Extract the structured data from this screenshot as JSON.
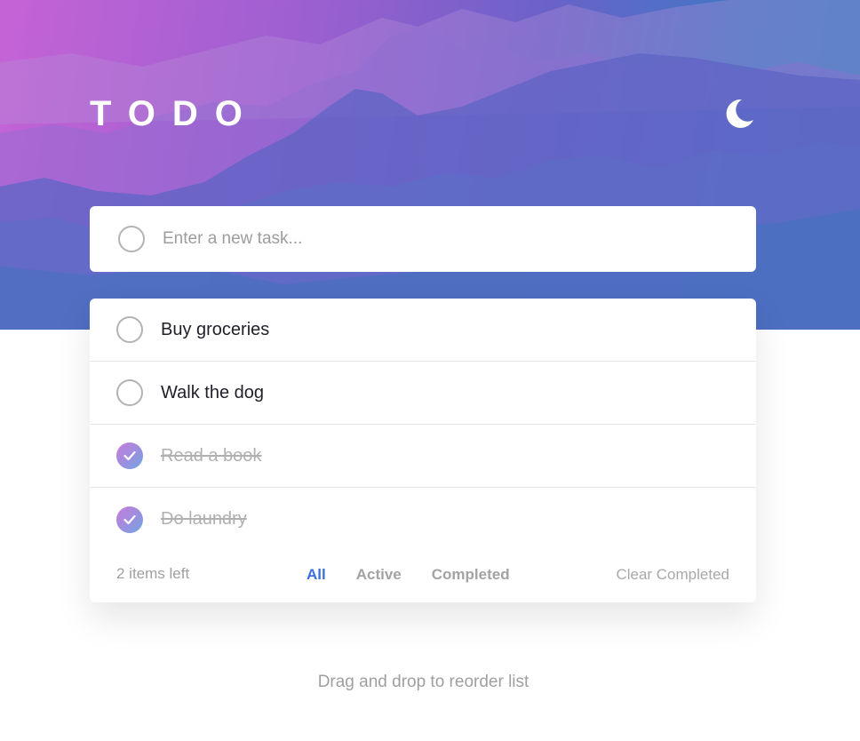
{
  "app": {
    "title": "TODO"
  },
  "new_task": {
    "placeholder": "Enter a new task..."
  },
  "tasks": [
    {
      "label": "Buy groceries",
      "completed": false
    },
    {
      "label": "Walk the dog",
      "completed": false
    },
    {
      "label": "Read a book",
      "completed": true
    },
    {
      "label": "Do laundry",
      "completed": true
    }
  ],
  "footer": {
    "items_left": "2 items left",
    "filters": [
      "All",
      "Active",
      "Completed"
    ],
    "active_filter": "All",
    "clear_completed": "Clear Completed"
  },
  "hint": "Drag and drop to reorder list",
  "icons": {
    "theme_toggle": "moon-icon",
    "check": "check-icon"
  },
  "colors": {
    "active_filter": "#3a6fe0",
    "check_gradient_start": "#c77ddd",
    "check_gradient_end": "#6fa8e0"
  }
}
